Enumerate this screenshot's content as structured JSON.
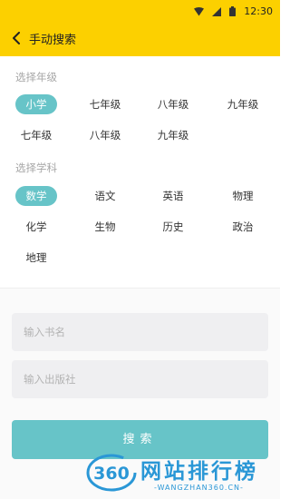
{
  "status_bar": {
    "time": "12:30"
  },
  "header": {
    "title": "手动搜索"
  },
  "grade_section": {
    "label": "选择年级",
    "rows": [
      [
        "小学",
        "七年级",
        "八年级",
        "九年级"
      ],
      [
        "七年级",
        "八年级",
        "九年级"
      ]
    ],
    "selected": "小学"
  },
  "subject_section": {
    "label": "选择学科",
    "rows": [
      [
        "数学",
        "语文",
        "英语",
        "物理"
      ],
      [
        "化学",
        "生物",
        "历史",
        "政治"
      ],
      [
        "地理"
      ]
    ],
    "selected": "数学"
  },
  "form": {
    "book_name_placeholder": "输入书名",
    "publisher_placeholder": "输入出版社",
    "search_label": "搜索"
  },
  "watermark": {
    "logo_text": "360",
    "text": "网站排行榜",
    "subtext": "-WANGZHAN360.CN-"
  },
  "colors": {
    "header_bg": "#fcd000",
    "accent": "#67c4c8"
  }
}
